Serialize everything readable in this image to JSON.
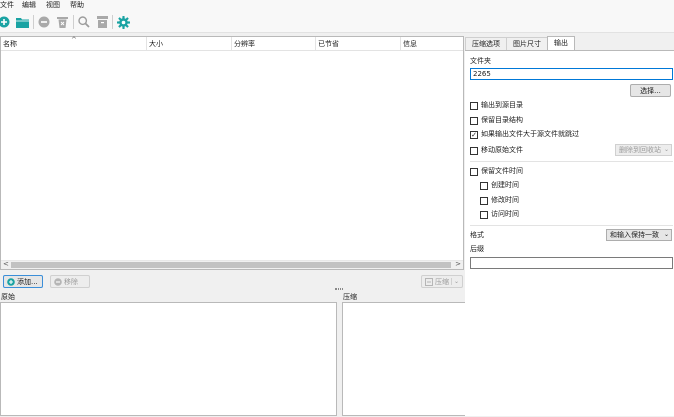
{
  "menu": {
    "file": "文件",
    "edit": "编辑",
    "view": "视图",
    "help": "帮助"
  },
  "toolbar_icons": [
    "add-icon",
    "open-folder-icon",
    "remove-icon",
    "clear-icon",
    "search-icon",
    "archive-icon",
    "settings-icon"
  ],
  "colors": {
    "accent": "#1aa3a3",
    "disabled_icon": "#9c9c9c",
    "focus_border": "#0078d7"
  },
  "file_list": {
    "columns": [
      "名称",
      "大小",
      "分辨率",
      "已节省",
      "信息"
    ]
  },
  "actions": {
    "add": "添加...",
    "remove": "移除",
    "compress": "压缩"
  },
  "panes": {
    "original": "原始",
    "compressed": "压缩"
  },
  "tabs": [
    "压缩选项",
    "图片尺寸",
    "输出"
  ],
  "output": {
    "folder_label": "文件夹",
    "folder_value": "2265",
    "browse": "选择...",
    "same_folder": "输出到源目录",
    "keep_structure": "保留目录结构",
    "skip_if_larger": "如果输出文件大于源文件就跳过",
    "move_originals": "移动原始文件",
    "delete_to_recycle": "删除到回收站",
    "keep_dates": "保留文件时间",
    "created": "创建时间",
    "modified": "修改时间",
    "accessed": "访问时间",
    "format_label": "格式",
    "format_value": "和输入保持一致",
    "suffix_label": "后缀",
    "suffix_value": ""
  },
  "checkboxes": {
    "same_folder": false,
    "keep_structure": false,
    "skip_if_larger": true,
    "move_originals": false,
    "keep_dates": false,
    "created": false,
    "modified": false,
    "accessed": false
  }
}
